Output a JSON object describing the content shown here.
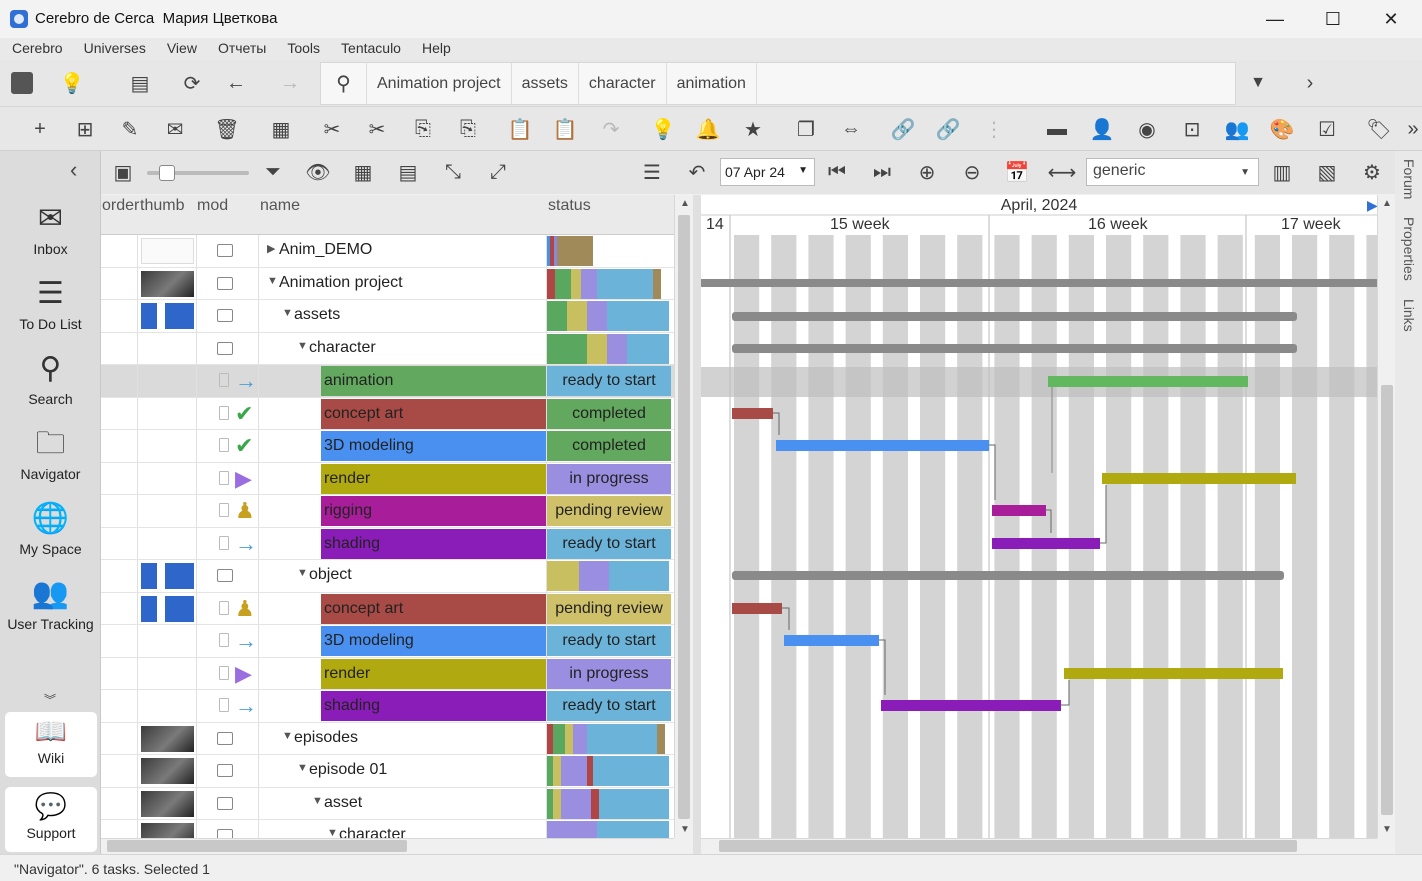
{
  "window": {
    "app_name": "Cerebro de Cerca",
    "user_name": "Мария Цветкова"
  },
  "menu": [
    "Cerebro",
    "Universes",
    "View",
    "Отчеты",
    "Tools",
    "Tentaculo",
    "Help"
  ],
  "path": [
    "Animation project",
    "assets",
    "character",
    "animation"
  ],
  "sidebar": {
    "items": [
      {
        "label": "Inbox",
        "icon": "envelope-icon"
      },
      {
        "label": "To Do List",
        "icon": "list-icon"
      },
      {
        "label": "Search",
        "icon": "search-icon"
      },
      {
        "label": "Navigator",
        "icon": "folder-icon"
      },
      {
        "label": "My Space",
        "icon": "globe-icon"
      },
      {
        "label": "User Tracking",
        "icon": "users-icon"
      }
    ],
    "wiki": "Wiki",
    "support": "Support"
  },
  "toolbar3": {
    "date": "07 Apr 24",
    "profile": "generic"
  },
  "table": {
    "columns": [
      "order",
      "thumb",
      "mod",
      "name",
      "status"
    ],
    "rows": [
      {
        "name": "Anim_DEMO",
        "level": 0,
        "expand": "▶",
        "thumb": "doc",
        "kind": "folder",
        "mix": [
          [
            "#4a90e2",
            3
          ],
          [
            "#b04545",
            4
          ],
          [
            "#8888dd",
            3
          ],
          [
            "#a18a5a",
            36
          ]
        ]
      },
      {
        "name": "Animation project",
        "level": 0,
        "expand": "▼",
        "thumb": "dark",
        "kind": "folder",
        "mix": [
          [
            "#b04545",
            8
          ],
          [
            "#5aa860",
            16
          ],
          [
            "#c8c060",
            10
          ],
          [
            "#9a8ee0",
            16
          ],
          [
            "#6bb3d9",
            56
          ],
          [
            "#a18a5a",
            8
          ]
        ]
      },
      {
        "name": "assets",
        "level": 1,
        "expand": "▼",
        "thumb": "blue",
        "kind": "folder",
        "mix": [
          [
            "#5aa860",
            20
          ],
          [
            "#c8c060",
            20
          ],
          [
            "#9a8ee0",
            20
          ],
          [
            "#6bb3d9",
            62
          ]
        ]
      },
      {
        "name": "character",
        "level": 2,
        "expand": "▼",
        "thumb": "",
        "kind": "folder",
        "mix": [
          [
            "#5aa860",
            40
          ],
          [
            "#c8c060",
            20
          ],
          [
            "#9a8ee0",
            20
          ],
          [
            "#6bb3d9",
            42
          ]
        ]
      },
      {
        "name": "animation",
        "level": 3,
        "kind": "task",
        "color": "#62a85e",
        "status": "ready to start",
        "status_color": "#6bb3d9",
        "state": "→",
        "state_color": "#4aa0d6",
        "sel": true
      },
      {
        "name": "concept art",
        "level": 3,
        "kind": "task",
        "color": "#a84a45",
        "status": "completed",
        "status_color": "#62a85e",
        "state": "✔",
        "state_color": "#3aa84a"
      },
      {
        "name": "3D modeling",
        "level": 3,
        "kind": "task",
        "color": "#4a90f0",
        "status": "completed",
        "status_color": "#62a85e",
        "state": "✔",
        "state_color": "#3aa84a"
      },
      {
        "name": "render",
        "level": 3,
        "kind": "task",
        "color": "#b0aa10",
        "status": "in progress",
        "status_color": "#9a8ee0",
        "state": "▶",
        "state_color": "#9a6ee0"
      },
      {
        "name": "rigging",
        "level": 3,
        "kind": "task",
        "color": "#a81d9a",
        "status": "pending review",
        "status_color": "#cfc06a",
        "state": "♟",
        "state_color": "#c8a020"
      },
      {
        "name": "shading",
        "level": 3,
        "kind": "task",
        "color": "#8a1db8",
        "status": "ready to start",
        "status_color": "#6bb3d9",
        "state": "→",
        "state_color": "#4aa0d6"
      },
      {
        "name": "object",
        "level": 2,
        "expand": "▼",
        "thumb": "blue",
        "kind": "folder",
        "mix": [
          [
            "#c8c060",
            32
          ],
          [
            "#9a8ee0",
            30
          ],
          [
            "#6bb3d9",
            60
          ]
        ]
      },
      {
        "name": "concept art",
        "level": 3,
        "kind": "task",
        "color": "#a84a45",
        "status": "pending review",
        "status_color": "#cfc06a",
        "state": "♟",
        "state_color": "#c8a020",
        "thumb": "blue"
      },
      {
        "name": "3D modeling",
        "level": 3,
        "kind": "task",
        "color": "#4a90f0",
        "status": "ready to start",
        "status_color": "#6bb3d9",
        "state": "→",
        "state_color": "#4aa0d6"
      },
      {
        "name": "render",
        "level": 3,
        "kind": "task",
        "color": "#b0aa10",
        "status": "in progress",
        "status_color": "#9a8ee0",
        "state": "▶",
        "state_color": "#9a6ee0"
      },
      {
        "name": "shading",
        "level": 3,
        "kind": "task",
        "color": "#8a1db8",
        "status": "ready to start",
        "status_color": "#6bb3d9",
        "state": "→",
        "state_color": "#4aa0d6"
      },
      {
        "name": "episodes",
        "level": 1,
        "expand": "▼",
        "thumb": "dark",
        "kind": "folder",
        "mix": [
          [
            "#b04545",
            6
          ],
          [
            "#5aa860",
            12
          ],
          [
            "#c8c060",
            8
          ],
          [
            "#9a8ee0",
            14
          ],
          [
            "#6bb3d9",
            70
          ],
          [
            "#a18a5a",
            8
          ]
        ]
      },
      {
        "name": "episode 01",
        "level": 2,
        "expand": "▼",
        "thumb": "dark",
        "kind": "folder",
        "mix": [
          [
            "#5aa860",
            6
          ],
          [
            "#c8c060",
            8
          ],
          [
            "#9a8ee0",
            26
          ],
          [
            "#b04545",
            6
          ],
          [
            "#6bb3d9",
            76
          ]
        ]
      },
      {
        "name": "asset",
        "level": 3,
        "expand": "▼",
        "thumb": "dark",
        "kind": "folder",
        "mix": [
          [
            "#5aa860",
            6
          ],
          [
            "#c8c060",
            8
          ],
          [
            "#9a8ee0",
            30
          ],
          [
            "#b04545",
            8
          ],
          [
            "#6bb3d9",
            70
          ]
        ]
      },
      {
        "name": "character",
        "level": 4,
        "expand": "▼",
        "thumb": "dark",
        "kind": "folder",
        "mix": [
          [
            "#9a8ee0",
            50
          ],
          [
            "#6bb3d9",
            72
          ]
        ]
      }
    ]
  },
  "gantt": {
    "month": "April, 2024",
    "weeks": [
      "14",
      "15 week",
      "16 week",
      "17 week"
    ]
  },
  "right_tabs": [
    "Forum",
    "Properties",
    "Links"
  ],
  "status_bar": "\"Navigator\". 6 tasks. Selected 1"
}
